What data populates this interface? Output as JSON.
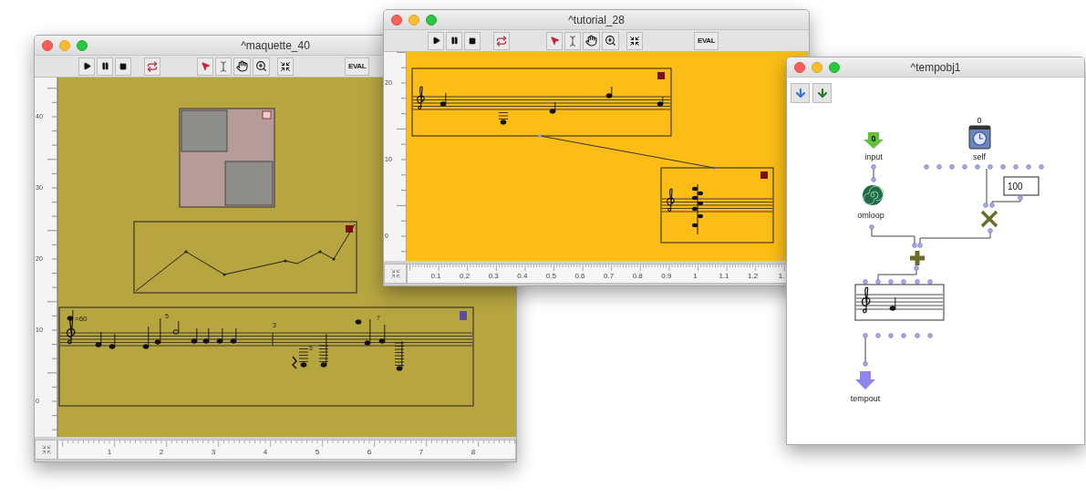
{
  "windows": [
    {
      "kind": "maquette",
      "title": "^maquette_40",
      "toolbar": {
        "eval_label": "EVAL"
      },
      "vertical_ruler": [
        "40",
        "30",
        "20",
        "10",
        "0"
      ],
      "horizontal_ruler": [
        "1",
        "2",
        "3",
        "4",
        "5",
        "6",
        "7",
        "8"
      ],
      "score": {
        "tempo": "=60",
        "tuplets": [
          "5",
          "3",
          "5",
          "7"
        ]
      }
    },
    {
      "kind": "tutorial",
      "title": "^tutorial_28",
      "toolbar": {
        "eval_label": "EVAL"
      },
      "vertical_ruler": [
        "20",
        "10",
        "0"
      ],
      "horizontal_ruler": [
        "0.1",
        "0.2",
        "0.3",
        "0.4",
        "0.5",
        "0.6",
        "0.7",
        "0.8",
        "0.9",
        "1",
        "1.1",
        "1.2",
        "1."
      ]
    },
    {
      "kind": "patch",
      "title": "^tempobj1",
      "boxes": [
        {
          "kind": "input",
          "label": "input",
          "value": "0"
        },
        {
          "kind": "self",
          "label": "self",
          "value": "0"
        },
        {
          "kind": "omloop",
          "label": "omloop"
        },
        {
          "kind": "number",
          "value": "100"
        },
        {
          "kind": "output",
          "label": "tempout"
        }
      ]
    }
  ]
}
